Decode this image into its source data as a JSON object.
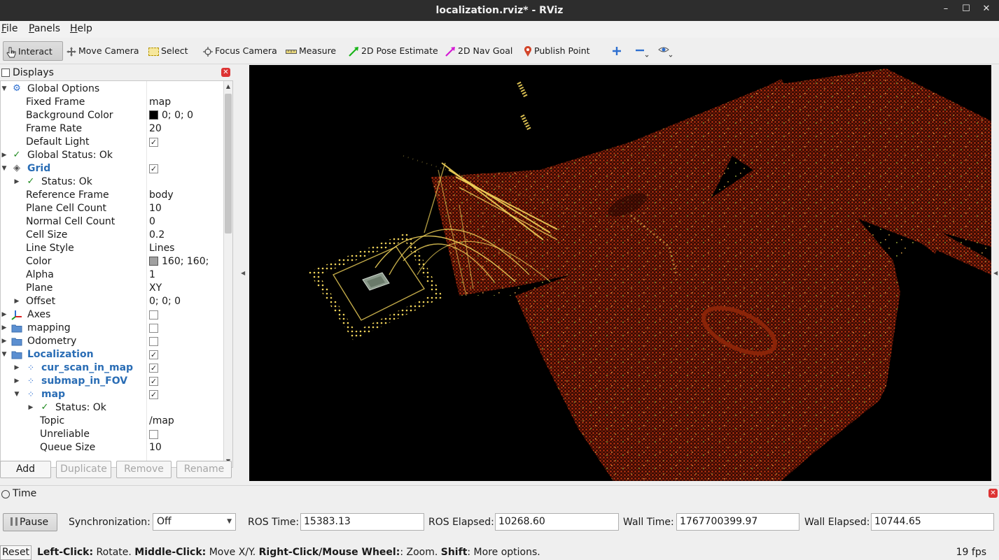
{
  "window": {
    "title": "localization.rviz* - RViz",
    "controls": [
      "–",
      "☐",
      "✕"
    ]
  },
  "menu": [
    {
      "accel": "F",
      "rest": "ile"
    },
    {
      "accel": "P",
      "rest": "anels"
    },
    {
      "accel": "H",
      "rest": "elp"
    }
  ],
  "toolbar": {
    "interact": "Interact",
    "move_camera": "Move Camera",
    "select": "Select",
    "focus_camera": "Focus Camera",
    "measure": "Measure",
    "pose_estimate": "2D Pose Estimate",
    "nav_goal": "2D Nav Goal",
    "publish_point": "Publish Point"
  },
  "displays": {
    "title": "Displays",
    "rows": [
      {
        "name": "Global Options",
        "value": ""
      },
      {
        "name": "Fixed Frame",
        "value": "map"
      },
      {
        "name": "Background Color",
        "value": "0; 0; 0",
        "swatch": "#000000"
      },
      {
        "name": "Frame Rate",
        "value": "20"
      },
      {
        "name": "Default Light",
        "value": ""
      },
      {
        "name": "Global Status: Ok",
        "value": ""
      },
      {
        "name": "Grid",
        "value": ""
      },
      {
        "name": "Status: Ok",
        "value": ""
      },
      {
        "name": "Reference Frame",
        "value": "body"
      },
      {
        "name": "Plane Cell Count",
        "value": "10"
      },
      {
        "name": "Normal Cell Count",
        "value": "0"
      },
      {
        "name": "Cell Size",
        "value": "0.2"
      },
      {
        "name": "Line Style",
        "value": "Lines"
      },
      {
        "name": "Color",
        "value": "160; 160;",
        "swatch": "#a0a0a0"
      },
      {
        "name": "Alpha",
        "value": "1"
      },
      {
        "name": "Plane",
        "value": "XY"
      },
      {
        "name": "Offset",
        "value": "0; 0; 0"
      },
      {
        "name": "Axes",
        "value": ""
      },
      {
        "name": "mapping",
        "value": ""
      },
      {
        "name": "Odometry",
        "value": ""
      },
      {
        "name": "Localization",
        "value": ""
      },
      {
        "name": "cur_scan_in_map",
        "value": ""
      },
      {
        "name": "submap_in_FOV",
        "value": ""
      },
      {
        "name": "map",
        "value": ""
      },
      {
        "name": "Status: Ok",
        "value": ""
      },
      {
        "name": "Topic",
        "value": "/map"
      },
      {
        "name": "Unreliable",
        "value": ""
      },
      {
        "name": "Queue Size",
        "value": "10"
      }
    ],
    "buttons": {
      "add": "Add",
      "duplicate": "Duplicate",
      "remove": "Remove",
      "rename": "Rename"
    }
  },
  "time": {
    "title": "Time",
    "pause": "Pause",
    "sync_label": "Synchronization:",
    "sync_value": "Off",
    "ros_time_label": "ROS Time:",
    "ros_time": "15383.13",
    "ros_elapsed_label": "ROS Elapsed:",
    "ros_elapsed": "10268.60",
    "wall_time_label": "Wall Time:",
    "wall_time": "1767700399.97",
    "wall_elapsed_label": "Wall Elapsed:",
    "wall_elapsed": "10744.65"
  },
  "status": {
    "reset": "Reset",
    "left_click": "Left-Click:",
    "left_click_desc": " Rotate. ",
    "middle_click": "Middle-Click:",
    "middle_click_desc": " Move X/Y. ",
    "right_click": "Right-Click/Mouse Wheel:",
    "right_click_desc": ": Zoom. ",
    "shift": "Shift",
    "shift_desc": ": More options.",
    "fps": "19 fps"
  },
  "colors": {
    "map_points": "#c0330e",
    "scan_points": "#f1d35a",
    "accent_blue": "#2a6db5",
    "ok_green": "#1f8a1f"
  }
}
